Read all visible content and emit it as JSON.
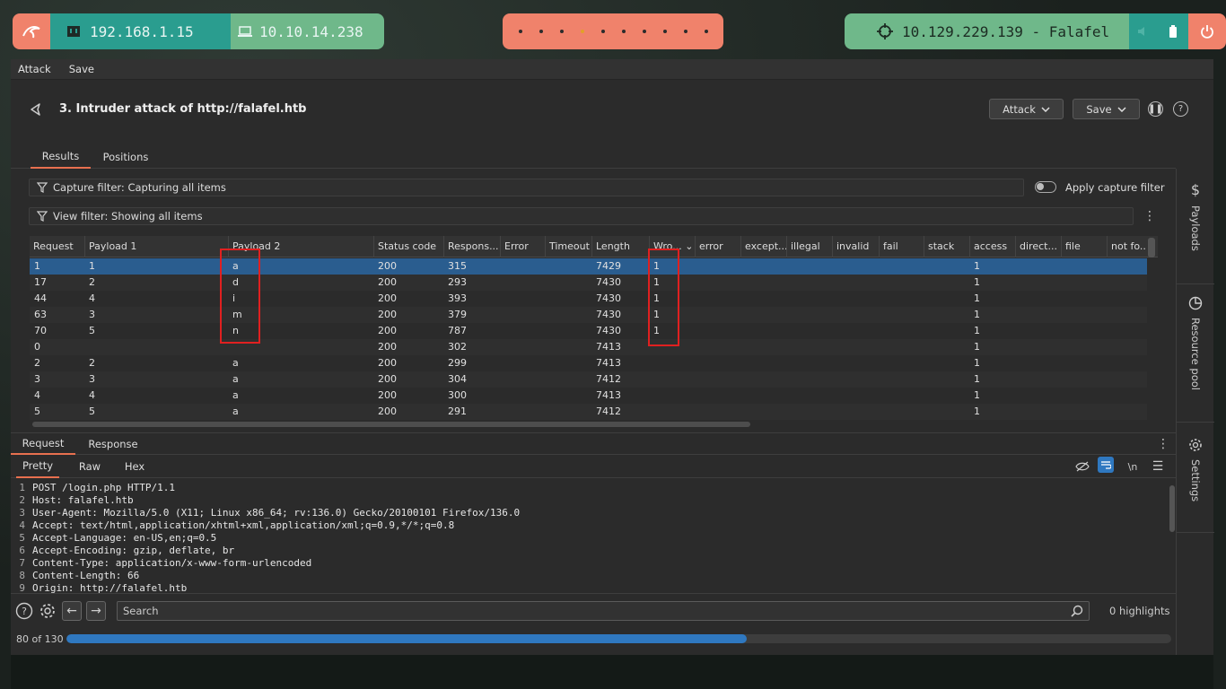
{
  "topbar": {
    "host_ip": "192.168.1.15",
    "vpn_ip": "10.10.14.238",
    "target": "10.129.229.139 - Falafel",
    "workspace_count": 10,
    "active_workspace": 4
  },
  "menu": {
    "attack": "Attack",
    "save": "Save"
  },
  "header": {
    "title": "3. Intruder attack of http://falafel.htb",
    "attack_button": "Attack",
    "save_button": "Save"
  },
  "tabs": {
    "results": "Results",
    "positions": "Positions"
  },
  "filters": {
    "capture": "Capture filter: Capturing all items",
    "apply_capture": "Apply capture filter",
    "view": "View filter: Showing all items"
  },
  "sidebar": {
    "payloads": "Payloads",
    "resource_pool": "Resource pool",
    "settings": "Settings"
  },
  "table": {
    "columns": [
      "Request",
      "Payload 1",
      "Payload 2",
      "Status code",
      "Respons...",
      "Error",
      "Timeout",
      "Length",
      "Wro...",
      "error",
      "except...",
      "illegal",
      "invalid",
      "fail",
      "stack",
      "access",
      "direct...",
      "file",
      "not fo..."
    ],
    "sorted_column": "Wro...",
    "rows": [
      {
        "req": "1",
        "p1": "1",
        "p2": "a",
        "status": "200",
        "resp": "315",
        "length": "7429",
        "wrong": "1",
        "access": "1",
        "selected": true
      },
      {
        "req": "17",
        "p1": "2",
        "p2": "d",
        "status": "200",
        "resp": "293",
        "length": "7430",
        "wrong": "1",
        "access": "1"
      },
      {
        "req": "44",
        "p1": "4",
        "p2": "i",
        "status": "200",
        "resp": "393",
        "length": "7430",
        "wrong": "1",
        "access": "1"
      },
      {
        "req": "63",
        "p1": "3",
        "p2": "m",
        "status": "200",
        "resp": "379",
        "length": "7430",
        "wrong": "1",
        "access": "1"
      },
      {
        "req": "70",
        "p1": "5",
        "p2": "n",
        "status": "200",
        "resp": "787",
        "length": "7430",
        "wrong": "1",
        "access": "1"
      },
      {
        "req": "0",
        "p1": "",
        "p2": "",
        "status": "200",
        "resp": "302",
        "length": "7413",
        "wrong": "",
        "access": "1"
      },
      {
        "req": "2",
        "p1": "2",
        "p2": "a",
        "status": "200",
        "resp": "299",
        "length": "7413",
        "wrong": "",
        "access": "1"
      },
      {
        "req": "3",
        "p1": "3",
        "p2": "a",
        "status": "200",
        "resp": "304",
        "length": "7412",
        "wrong": "",
        "access": "1"
      },
      {
        "req": "4",
        "p1": "4",
        "p2": "a",
        "status": "200",
        "resp": "300",
        "length": "7413",
        "wrong": "",
        "access": "1"
      },
      {
        "req": "5",
        "p1": "5",
        "p2": "a",
        "status": "200",
        "resp": "291",
        "length": "7412",
        "wrong": "",
        "access": "1"
      }
    ]
  },
  "detail": {
    "request_tab": "Request",
    "response_tab": "Response",
    "pretty": "Pretty",
    "raw": "Raw",
    "hex": "Hex",
    "newline_label": "\\n",
    "lines": [
      {
        "n": "1",
        "key": "",
        "val": "POST /login.php HTTP/1.1"
      },
      {
        "n": "2",
        "key": "Host:",
        "val": " falafel.htb"
      },
      {
        "n": "3",
        "key": "User-Agent:",
        "val": " Mozilla/5.0 (X11; Linux x86_64; rv:136.0) Gecko/20100101 Firefox/136.0"
      },
      {
        "n": "4",
        "key": "Accept:",
        "val": " text/html,application/xhtml+xml,application/xml;q=0.9,*/*;q=0.8"
      },
      {
        "n": "5",
        "key": "Accept-Language:",
        "val": " en-US,en;q=0.5"
      },
      {
        "n": "6",
        "key": "Accept-Encoding:",
        "val": " gzip, deflate, br"
      },
      {
        "n": "7",
        "key": "Content-Type:",
        "val": " application/x-www-form-urlencoded"
      },
      {
        "n": "8",
        "key": "Content-Length:",
        "val": " 66"
      },
      {
        "n": "9",
        "key": "Origin:",
        "val": " http://falafel.htb"
      }
    ]
  },
  "search": {
    "placeholder": "Search",
    "highlights": "0 highlights"
  },
  "progress": {
    "label": "80 of 130",
    "fraction": 0.6154
  }
}
